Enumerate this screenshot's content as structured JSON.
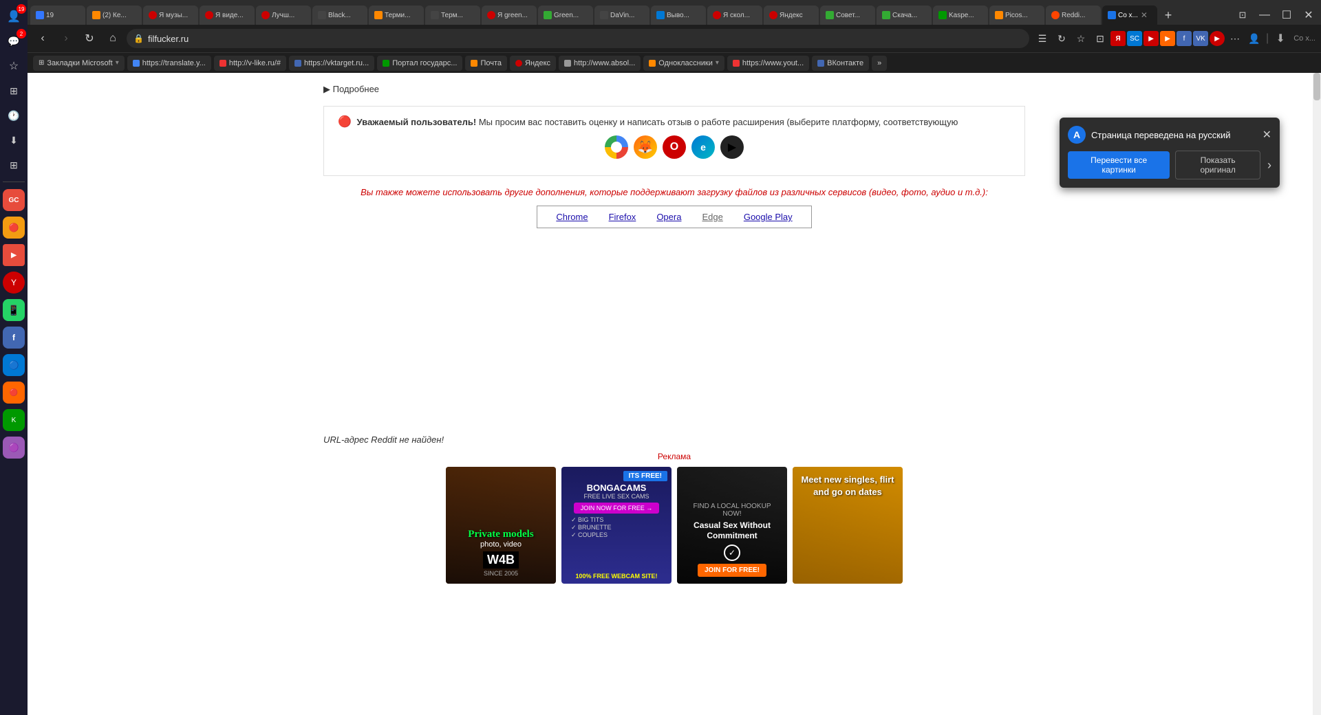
{
  "sidebar": {
    "icons": [
      {
        "name": "profile",
        "symbol": "👤",
        "badge": "19"
      },
      {
        "name": "chat",
        "symbol": "💬",
        "badge": "2"
      },
      {
        "name": "star",
        "symbol": "☆"
      },
      {
        "name": "grid",
        "symbol": "⊞"
      },
      {
        "name": "time",
        "symbol": "🕐"
      },
      {
        "name": "download",
        "symbol": "⬇"
      },
      {
        "name": "apps",
        "symbol": "⊞"
      },
      {
        "name": "app1",
        "symbol": "🔴",
        "color": "#e74c3c"
      },
      {
        "name": "app2",
        "symbol": "🟡",
        "color": "#f39c12"
      },
      {
        "name": "app3",
        "symbol": "🟣",
        "color": "#9b59b6"
      },
      {
        "name": "app4",
        "symbol": "🔵",
        "color": "#3498db"
      },
      {
        "name": "app5",
        "symbol": "🟢",
        "color": "#2ecc71"
      },
      {
        "name": "app6",
        "symbol": "🔴",
        "color": "#e74c3c"
      },
      {
        "name": "app7",
        "symbol": "🔵",
        "color": "#2980b9"
      },
      {
        "name": "app8",
        "symbol": "🟠",
        "color": "#e67e22"
      },
      {
        "name": "app9",
        "symbol": "🟣",
        "color": "#8e44ad"
      }
    ]
  },
  "tabs": [
    {
      "id": "t1",
      "label": "19",
      "favicon_color": "#e33",
      "badge": true
    },
    {
      "id": "t2",
      "label": "(2) Ке...",
      "favicon_color": "#f80"
    },
    {
      "id": "t3",
      "label": "Я музы...",
      "favicon_color": "#cc0000"
    },
    {
      "id": "t4",
      "label": "Я виде...",
      "favicon_color": "#cc0000"
    },
    {
      "id": "t5",
      "label": "Лучш...",
      "favicon_color": "#cc0000"
    },
    {
      "id": "t6",
      "label": "Black...",
      "favicon_color": "#222"
    },
    {
      "id": "t7",
      "label": "Терми...",
      "favicon_color": "#f80"
    },
    {
      "id": "t8",
      "label": "Терм...",
      "favicon_color": "#444"
    },
    {
      "id": "t9",
      "label": "Я green...",
      "favicon_color": "#cc0000"
    },
    {
      "id": "t10",
      "label": "Green...",
      "favicon_color": "#3a3"
    },
    {
      "id": "t11",
      "label": "DaVin...",
      "favicon_color": "#333"
    },
    {
      "id": "t12",
      "label": "Выво...",
      "favicon_color": "#0078d4"
    },
    {
      "id": "t13",
      "label": "Я скол...",
      "favicon_color": "#cc0000"
    },
    {
      "id": "t14",
      "label": "Яндекс",
      "favicon_color": "#cc0000"
    },
    {
      "id": "t15",
      "label": "Совет...",
      "favicon_color": "#3a3"
    },
    {
      "id": "t16",
      "label": "Скача...",
      "favicon_color": "#3a3"
    },
    {
      "id": "t17",
      "label": "Kaspe...",
      "favicon_color": "#009900"
    },
    {
      "id": "t18",
      "label": "Picos...",
      "favicon_color": "#f80"
    },
    {
      "id": "t19",
      "label": "Reddi...",
      "favicon_color": "#ff4500"
    },
    {
      "id": "t20",
      "label": "Со х...",
      "favicon_color": "#1a73e8",
      "active": true
    }
  ],
  "toolbar": {
    "back_disabled": false,
    "forward_disabled": false,
    "url": "filfucker.ru",
    "page_title": "Сохранение видео и аудио из Reddit"
  },
  "bookmarks": [
    {
      "label": "Закладки Microsoft",
      "has_arrow": true
    },
    {
      "label": "https://translate.y..."
    },
    {
      "label": "http://v-like.ru/#"
    },
    {
      "label": "https://vktarget.ru..."
    },
    {
      "label": "Портал государс..."
    },
    {
      "label": "Почта"
    },
    {
      "label": "Яндекс"
    },
    {
      "label": "http://www.absol..."
    },
    {
      "label": "Одноклассники",
      "has_arrow": true
    },
    {
      "label": "https://www.yout..."
    },
    {
      "label": "ВКонтакте"
    },
    {
      "label": "...другое",
      "is_more": true
    }
  ],
  "page": {
    "details_label": "▶ Подробнее",
    "notice_text": "Уважаемый пользователь! Мы просим вас поставить оценку и написать отзыв о работе расширения (выберите платформу, соответствующую",
    "browser_icons": [
      {
        "name": "chrome",
        "color": "#4285f4"
      },
      {
        "name": "firefox",
        "color": "#ff6611"
      },
      {
        "name": "opera",
        "color": "#cc0000"
      },
      {
        "name": "edge",
        "color": "#0078d4"
      },
      {
        "name": "gplay",
        "color": "#222"
      }
    ],
    "extensions_text": "Вы также можете использовать другие дополнения, которые поддерживают загрузку файлов из различных сервисов (видео, фото, аудио и т.д.):",
    "browser_links": [
      {
        "label": "Chrome",
        "url": "#"
      },
      {
        "label": "Firefox",
        "url": "#"
      },
      {
        "label": "Opera",
        "url": "#"
      },
      {
        "label": "Edge",
        "url": "#",
        "current": true
      },
      {
        "label": "Google Play",
        "url": "#"
      }
    ],
    "error_text": "URL-адрес Reddit не найден!",
    "ad_label": "Реклама",
    "ads": [
      {
        "type": "private_models",
        "title": "Private models",
        "subtitle": "photo, video",
        "brand": "W4B",
        "year": "SINCE 2005"
      },
      {
        "type": "bongacams",
        "header": "BONGACAMS",
        "subheader": "FREE LIVE SEX CAMS",
        "its_free": "ITS FREE!",
        "cta": "JOIN NOW FOR FREE →",
        "features": [
          "BIG TITS",
          "BRUNETTE",
          "COUPLES"
        ],
        "tagline": "100% FREE WEBCAM SITE!"
      },
      {
        "type": "casual_sex",
        "line1": "FIND A LOCAL HOOKUP NOW!",
        "line2": "Casual Sex Without Commitment",
        "cta": "JOIN FOR FREE!"
      },
      {
        "type": "meet_singles",
        "text": "Meet new singles, flirt and go on dates"
      }
    ]
  },
  "translation_popup": {
    "title": "Страница переведена на русский",
    "translate_all_btn": "Перевести все картинки",
    "show_original_btn": "Показать оригинал"
  }
}
